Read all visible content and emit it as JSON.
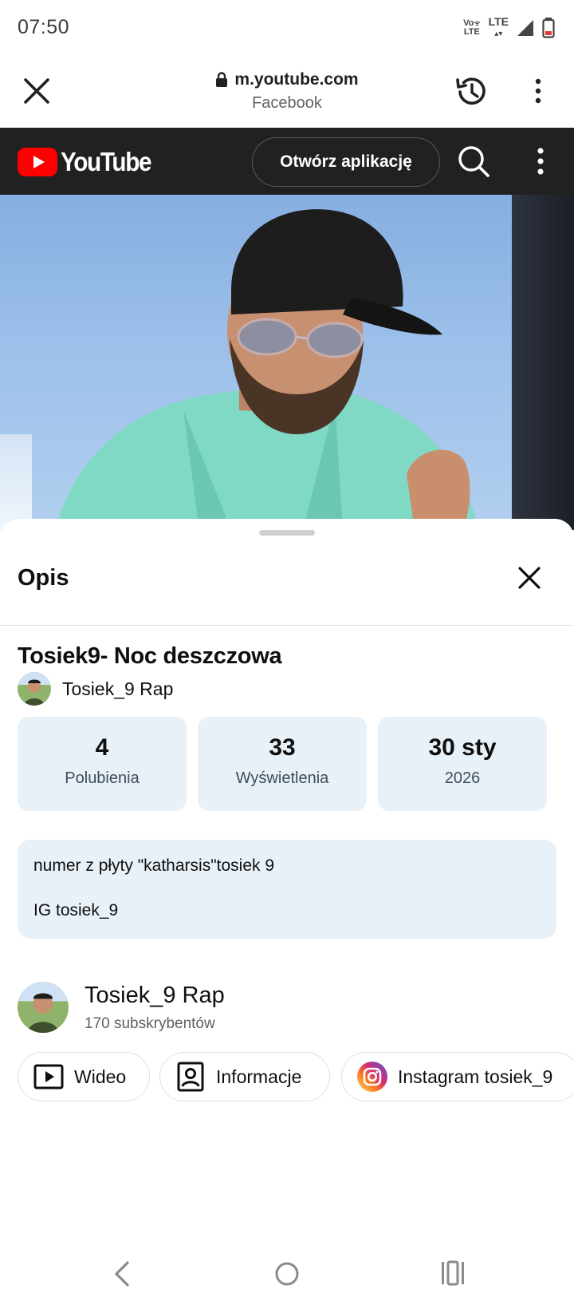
{
  "status_bar": {
    "time": "07:50",
    "volte_label": "Vo LTE",
    "network_label": "LTE"
  },
  "browser": {
    "url": "m.youtube.com",
    "source": "Facebook"
  },
  "youtube_header": {
    "logo_text": "YouTube",
    "open_app_label": "Otwórz aplikację"
  },
  "sheet": {
    "title": "Opis",
    "video_title": "Tosiek9- Noc deszczowa",
    "channel_name": "Tosiek_9 Rap",
    "stats": [
      {
        "value": "4",
        "label": "Polubienia"
      },
      {
        "value": "33",
        "label": "Wyświetlenia"
      },
      {
        "value": "30 sty",
        "label": "2026"
      }
    ],
    "description": [
      "numer z płyty \"katharsis\"tosiek 9",
      "IG tosiek_9"
    ],
    "channel_card": {
      "name": "Tosiek_9 Rap",
      "subscribers": "170 subskrybentów"
    },
    "chips": [
      {
        "label": "Wideo",
        "icon": "play-box-icon"
      },
      {
        "label": "Informacje",
        "icon": "portrait-icon"
      },
      {
        "label": "Instagram tosiek_9",
        "icon": "instagram-icon"
      }
    ]
  },
  "colors": {
    "yt_header_bg": "#212121",
    "yt_red": "#ff0000",
    "stat_bg": "#e8f1f8"
  }
}
